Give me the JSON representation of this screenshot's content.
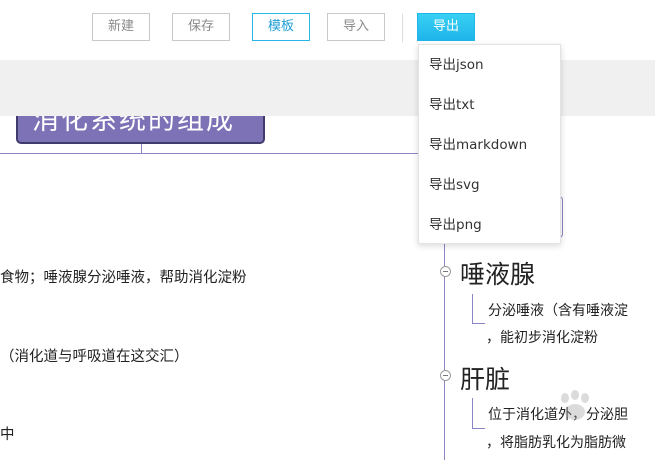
{
  "toolbar": {
    "new_label": "新建",
    "save_label": "保存",
    "template_label": "模板",
    "import_label": "导入",
    "export_label": "导出"
  },
  "export_menu": {
    "items": [
      "导出json",
      "导出txt",
      "导出markdown",
      "导出svg",
      "导出png"
    ]
  },
  "mindmap": {
    "root_title": "消化系统的组成",
    "left_lines": [
      "食物；唾液腺分泌唾液，帮助消化淀粉",
      "（消化道与呼吸道在这交汇）",
      "中"
    ],
    "nodes": [
      {
        "title": "唾液腺",
        "lines": [
          "分泌唾液（含有唾液淀",
          "，能初步消化淀粉"
        ]
      },
      {
        "title": "肝脏",
        "lines": [
          "位于消化道外，分泌胆",
          "，将脂肪乳化为脂肪微"
        ]
      }
    ]
  },
  "colors": {
    "accent": "#1fb4ea",
    "root_fill": "#7d72b6",
    "connector": "#8a86c4"
  }
}
